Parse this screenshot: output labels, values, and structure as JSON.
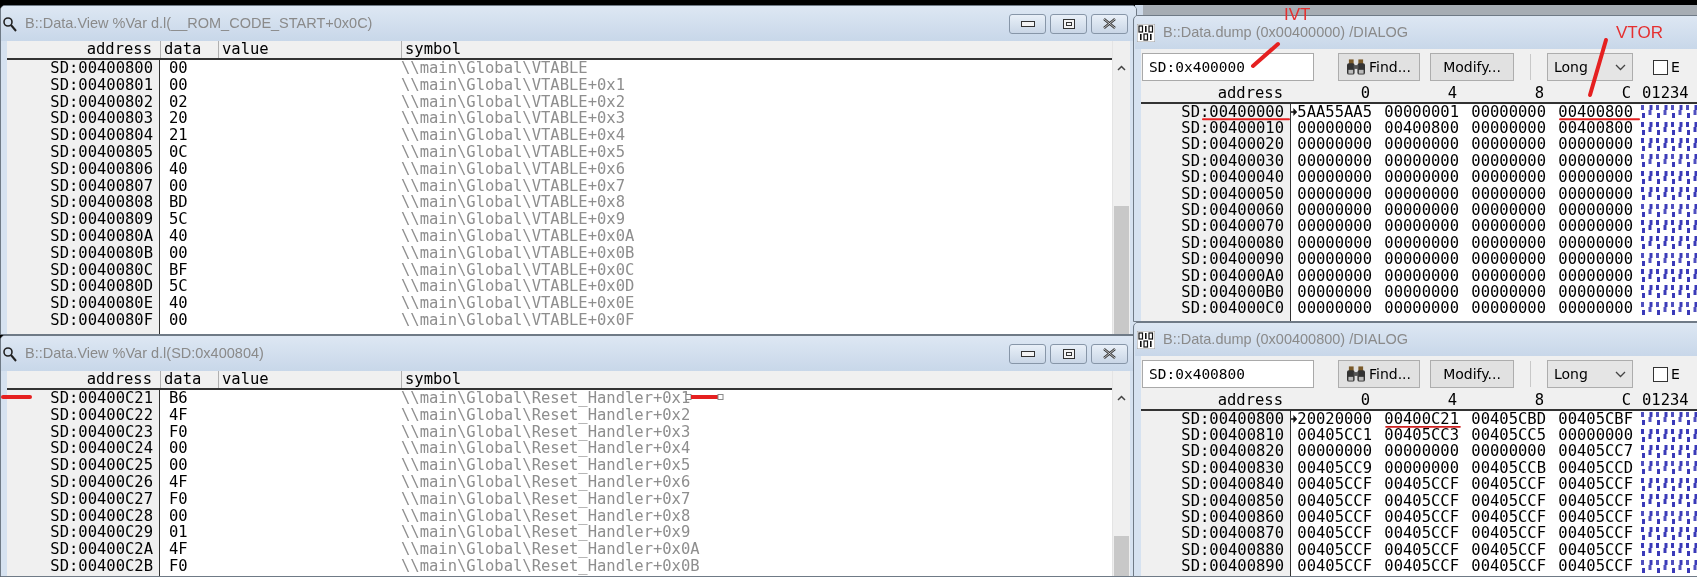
{
  "desktop": {
    "windows": [
      {
        "kind": "view",
        "title": "B::Data.View %Var d.l(__ROM_CODE_START+0x0C)",
        "columns": [
          "address",
          "data",
          "value",
          "symbol"
        ],
        "rows": [
          {
            "address": "SD:00400800",
            "data": "00",
            "symbol": "\\\\main\\Global\\VTABLE"
          },
          {
            "address": "SD:00400801",
            "data": "00",
            "symbol": "\\\\main\\Global\\VTABLE+0x1"
          },
          {
            "address": "SD:00400802",
            "data": "02",
            "symbol": "\\\\main\\Global\\VTABLE+0x2"
          },
          {
            "address": "SD:00400803",
            "data": "20",
            "symbol": "\\\\main\\Global\\VTABLE+0x3"
          },
          {
            "address": "SD:00400804",
            "data": "21",
            "symbol": "\\\\main\\Global\\VTABLE+0x4"
          },
          {
            "address": "SD:00400805",
            "data": "0C",
            "symbol": "\\\\main\\Global\\VTABLE+0x5"
          },
          {
            "address": "SD:00400806",
            "data": "40",
            "symbol": "\\\\main\\Global\\VTABLE+0x6"
          },
          {
            "address": "SD:00400807",
            "data": "00",
            "symbol": "\\\\main\\Global\\VTABLE+0x7"
          },
          {
            "address": "SD:00400808",
            "data": "BD",
            "symbol": "\\\\main\\Global\\VTABLE+0x8"
          },
          {
            "address": "SD:00400809",
            "data": "5C",
            "symbol": "\\\\main\\Global\\VTABLE+0x9"
          },
          {
            "address": "SD:0040080A",
            "data": "40",
            "symbol": "\\\\main\\Global\\VTABLE+0x0A"
          },
          {
            "address": "SD:0040080B",
            "data": "00",
            "symbol": "\\\\main\\Global\\VTABLE+0x0B"
          },
          {
            "address": "SD:0040080C",
            "data": "BF",
            "symbol": "\\\\main\\Global\\VTABLE+0x0C"
          },
          {
            "address": "SD:0040080D",
            "data": "5C",
            "symbol": "\\\\main\\Global\\VTABLE+0x0D"
          },
          {
            "address": "SD:0040080E",
            "data": "40",
            "symbol": "\\\\main\\Global\\VTABLE+0x0E"
          },
          {
            "address": "SD:0040080F",
            "data": "00",
            "symbol": "\\\\main\\Global\\VTABLE+0x0F"
          }
        ]
      },
      {
        "kind": "dump",
        "title": "B::Data.dump (0x00400000) /DIALOG",
        "address_field": {
          "value": "SD:0x400000"
        },
        "buttons": [
          "Find...",
          "Modify..."
        ],
        "format": {
          "value": "Long"
        },
        "checkbox": {
          "label": "E",
          "checked": false
        },
        "columns": [
          "address",
          "0",
          "4",
          "8",
          "C",
          "01234"
        ],
        "rows": [
          {
            "cells": [
              "SD:00400000",
              "5AA55AA5",
              "00000001",
              "00000000",
              "00400800"
            ],
            "current": true
          },
          {
            "cells": [
              "SD:00400010",
              "00000000",
              "00400800",
              "00000000",
              "00400800"
            ],
            "current": false
          },
          {
            "cells": [
              "SD:00400020",
              "00000000",
              "00000000",
              "00000000",
              "00000000"
            ],
            "current": false
          },
          {
            "cells": [
              "SD:00400030",
              "00000000",
              "00000000",
              "00000000",
              "00000000"
            ],
            "current": false
          },
          {
            "cells": [
              "SD:00400040",
              "00000000",
              "00000000",
              "00000000",
              "00000000"
            ],
            "current": false
          },
          {
            "cells": [
              "SD:00400050",
              "00000000",
              "00000000",
              "00000000",
              "00000000"
            ],
            "current": false
          },
          {
            "cells": [
              "SD:00400060",
              "00000000",
              "00000000",
              "00000000",
              "00000000"
            ],
            "current": false
          },
          {
            "cells": [
              "SD:00400070",
              "00000000",
              "00000000",
              "00000000",
              "00000000"
            ],
            "current": false
          },
          {
            "cells": [
              "SD:00400080",
              "00000000",
              "00000000",
              "00000000",
              "00000000"
            ],
            "current": false
          },
          {
            "cells": [
              "SD:00400090",
              "00000000",
              "00000000",
              "00000000",
              "00000000"
            ],
            "current": false
          },
          {
            "cells": [
              "SD:004000A0",
              "00000000",
              "00000000",
              "00000000",
              "00000000"
            ],
            "current": false
          },
          {
            "cells": [
              "SD:004000B0",
              "00000000",
              "00000000",
              "00000000",
              "00000000"
            ],
            "current": false
          },
          {
            "cells": [
              "SD:004000C0",
              "00000000",
              "00000000",
              "00000000",
              "00000000"
            ],
            "current": false
          }
        ]
      },
      {
        "kind": "view",
        "title": "B::Data.View %Var d.l(SD:0x400804)",
        "columns": [
          "address",
          "data",
          "value",
          "symbol"
        ],
        "rows": [
          {
            "address": "SD:00400C21",
            "data": "B6",
            "symbol": "\\\\main\\Global\\Reset_Handler+0x1"
          },
          {
            "address": "SD:00400C22",
            "data": "4F",
            "symbol": "\\\\main\\Global\\Reset_Handler+0x2"
          },
          {
            "address": "SD:00400C23",
            "data": "F0",
            "symbol": "\\\\main\\Global\\Reset_Handler+0x3"
          },
          {
            "address": "SD:00400C24",
            "data": "00",
            "symbol": "\\\\main\\Global\\Reset_Handler+0x4"
          },
          {
            "address": "SD:00400C25",
            "data": "00",
            "symbol": "\\\\main\\Global\\Reset_Handler+0x5"
          },
          {
            "address": "SD:00400C26",
            "data": "4F",
            "symbol": "\\\\main\\Global\\Reset_Handler+0x6"
          },
          {
            "address": "SD:00400C27",
            "data": "F0",
            "symbol": "\\\\main\\Global\\Reset_Handler+0x7"
          },
          {
            "address": "SD:00400C28",
            "data": "00",
            "symbol": "\\\\main\\Global\\Reset_Handler+0x8"
          },
          {
            "address": "SD:00400C29",
            "data": "01",
            "symbol": "\\\\main\\Global\\Reset_Handler+0x9"
          },
          {
            "address": "SD:00400C2A",
            "data": "4F",
            "symbol": "\\\\main\\Global\\Reset_Handler+0x0A"
          },
          {
            "address": "SD:00400C2B",
            "data": "F0",
            "symbol": "\\\\main\\Global\\Reset_Handler+0x0B"
          }
        ]
      },
      {
        "kind": "dump",
        "title": "B::Data.dump (0x00400800) /DIALOG",
        "address_field": {
          "value": "SD:0x400800"
        },
        "buttons": [
          "Find...",
          "Modify..."
        ],
        "format": {
          "value": "Long"
        },
        "checkbox": {
          "label": "E",
          "checked": false
        },
        "columns": [
          "address",
          "0",
          "4",
          "8",
          "C",
          "01234"
        ],
        "rows": [
          {
            "cells": [
              "SD:00400800",
              "20020000",
              "00400C21",
              "00405CBD",
              "00405CBF"
            ],
            "current": true
          },
          {
            "cells": [
              "SD:00400810",
              "00405CC1",
              "00405CC3",
              "00405CC5",
              "00000000"
            ],
            "current": false
          },
          {
            "cells": [
              "SD:00400820",
              "00000000",
              "00000000",
              "00000000",
              "00405CC7"
            ],
            "current": false
          },
          {
            "cells": [
              "SD:00400830",
              "00405CC9",
              "00000000",
              "00405CCB",
              "00405CCD"
            ],
            "current": false
          },
          {
            "cells": [
              "SD:00400840",
              "00405CCF",
              "00405CCF",
              "00405CCF",
              "00405CCF"
            ],
            "current": false
          },
          {
            "cells": [
              "SD:00400850",
              "00405CCF",
              "00405CCF",
              "00405CCF",
              "00405CCF"
            ],
            "current": false
          },
          {
            "cells": [
              "SD:00400860",
              "00405CCF",
              "00405CCF",
              "00405CCF",
              "00405CCF"
            ],
            "current": false
          },
          {
            "cells": [
              "SD:00400870",
              "00405CCF",
              "00405CCF",
              "00405CCF",
              "00405CCF"
            ],
            "current": false
          },
          {
            "cells": [
              "SD:00400880",
              "00405CCF",
              "00405CCF",
              "00405CCF",
              "00405CCF"
            ],
            "current": false
          },
          {
            "cells": [
              "SD:00400890",
              "00405CCF",
              "00405CCF",
              "00405CCF",
              "00405CCF"
            ],
            "current": false
          }
        ]
      }
    ]
  },
  "annotations": {
    "labels": [
      {
        "text": "IVT"
      },
      {
        "text": "VTOR"
      }
    ]
  }
}
